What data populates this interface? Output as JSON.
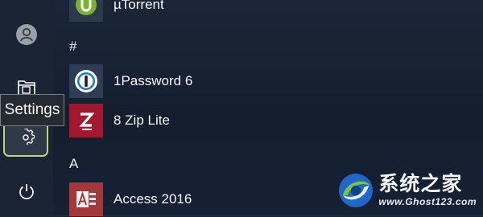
{
  "tooltip": {
    "text": "Settings"
  },
  "sections": {
    "hash": "#",
    "a": "A"
  },
  "apps": [
    {
      "label": "µTorrent",
      "icon": "utorrent-icon"
    },
    {
      "label": "1Password 6",
      "icon": "onepassword-icon"
    },
    {
      "label": "8 Zip Lite",
      "icon": "8zip-icon"
    },
    {
      "label": "Access 2016",
      "icon": "access-icon"
    }
  ],
  "rail": {
    "avatar_icon": "user-avatar-icon",
    "documents_icon": "documents-icon",
    "settings_icon": "gear-icon",
    "power_icon": "power-icon"
  },
  "watermark": {
    "title": "系统之家",
    "url": "www.Ghost123.com"
  },
  "colors": {
    "settings_highlight": "#b7d67a",
    "rail_bg": "#1b2434",
    "background": "#141e2d"
  }
}
